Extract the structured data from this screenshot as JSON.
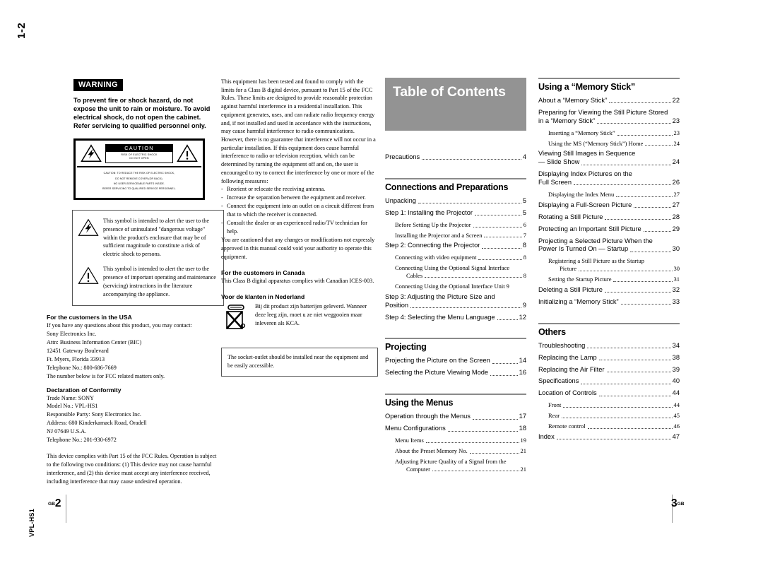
{
  "page": {
    "section_marker": "1-2",
    "model_marker": "VPL-HS1",
    "footer_left_page": "2",
    "footer_left_suffix": "GB",
    "footer_right_page": "3",
    "footer_right_suffix": "GB"
  },
  "warning": {
    "badge": "WARNING",
    "body": "To prevent fire or shock hazard, do not expose the unit to rain or moisture.\nTo avoid electrical shock, do not open the cabinet.  Refer servicing to qualified personnel only."
  },
  "caution_label": {
    "word": "CAUTION",
    "sub_line1": "RISK OF ELECTRIC SHOCK",
    "sub_line2": "DO NOT OPEN",
    "bottom_lines": [
      "CAUTION: TO REDUCE THE RISK OF ELECTRIC SHOCK,",
      "DO NOT REMOVE COVER (OR BACK).",
      "NO USER-SERVICEABLE PARTS INSIDE.",
      "REFER SERVICING TO QUALIFIED SERVICE PERSONNEL."
    ]
  },
  "symbol_box": {
    "lightning_text": "This symbol is intended to alert the user to the presence of uninsulated \"dangerous voltage\" within the product's enclosure that may be of sufficient magnitude to constitute a risk of electric shock to persons.",
    "exclamation_text": "This symbol is intended to alert the user to the presence of important operating and maintenance (servicing) instructions in the literature accompanying the appliance."
  },
  "usa": {
    "heading": "For the customers in the USA",
    "intro": "If you have any questions about this product, you may contact:",
    "address_lines": [
      "Sony Electronics Inc.",
      "Attn: Business Information Center (BIC)",
      "12451 Gateway Boulevard",
      "Ft. Myers, Florida 33913",
      "Telephone No.: 800-686-7669"
    ],
    "note": "The number below is for FCC related matters only."
  },
  "doc": {
    "heading": "Declaration of Conformity",
    "lines": [
      "Trade Name: SONY",
      "Model No.: VPL-HS1",
      "Responsible Party: Sony Electronics Inc.",
      "Address: 680 Kinderkamack Road, Oradell",
      "NJ 07649 U.S.A.",
      "Telephone No.: 201-930-6972"
    ]
  },
  "fcc_part15": "This device complies with Part 15 of the FCC Rules. Operation is subject to the following two conditions: (1) This device may not cause harmful interference, and (2) this device must accept any interference received, including interference that may cause undesired operation.",
  "fcc_statement": {
    "paragraph": "This equipment has been tested and found to comply with the limits for a Class B digital device, pursuant to Part 15 of the FCC Rules.  These limits are designed to provide reasonable protection against harmful interference in a residential installation.  This equipment generates, uses, and can radiate radio frequency energy and, if not installed and used in accordance with the instructions, may cause harmful interference to radio communications.  However, there is no guarantee that interference will not occur in a particular installation. If this equipment does cause harmful interference to radio or television reception, which can be determined by turning the equipment off and on, the user is encouraged to try to correct the interference by one or more of the following measures:",
    "measures": [
      "Reorient or relocate the receiving antenna.",
      "Increase the separation between the equipment and receiver.",
      "Connect the equipment into an outlet on a circuit different from that to which the receiver is connected.",
      "Consult the dealer or an experienced radio/TV technician for help."
    ],
    "caution": "You are cautioned that any changes or modifications not expressly approved in this manual could void your authority to operate this equipment."
  },
  "canada": {
    "heading": "For the customers in Canada",
    "body": "This Class B digital apparatus complies with Canadian ICES-003."
  },
  "netherlands": {
    "heading": "Voor de klanten in Nederland",
    "body": "Bij dit product zijn batterijen geleverd. Wanneer deze leeg zijn, moet u ze niet weggooien maar inleveren als KCA."
  },
  "socket_note": "The socket-outlet should be installed near the equipment and be easily accessible.",
  "toc": {
    "title": "Table of Contents",
    "precautions": {
      "label": "Precautions",
      "page": "4"
    },
    "sections": [
      {
        "heading": "Connections and Preparations",
        "entries": [
          {
            "label": "Unpacking",
            "page": "5",
            "level": "main"
          },
          {
            "label": "Step 1: Installing the Projector",
            "page": "5",
            "level": "main"
          },
          {
            "label": "Before Setting Up the Projector",
            "page": "6",
            "level": "sub"
          },
          {
            "label": "Installing the Projector and a Screen",
            "page": "7",
            "level": "sub"
          },
          {
            "label": "Step 2: Connecting the Projector",
            "page": "8",
            "level": "main"
          },
          {
            "label": "Connecting with video equipment",
            "page": "8",
            "level": "sub"
          },
          {
            "line1": "Connecting Using the Optional Signal Interface",
            "line2": "Cables",
            "page": "8",
            "level": "sub-multi"
          },
          {
            "line1": "Connecting Using the Optional Interface Unit 9",
            "line2": "",
            "page": "",
            "level": "sub-nodots"
          },
          {
            "line1": "Step 3: Adjusting the Picture Size and",
            "line2": "Position",
            "page": "9",
            "level": "main-multi"
          },
          {
            "label": "Step 4: Selecting the Menu Language",
            "page": "12",
            "level": "main"
          }
        ]
      },
      {
        "heading": "Projecting",
        "entries": [
          {
            "label": "Projecting the Picture on the Screen",
            "page": "14",
            "level": "main"
          },
          {
            "label": "Selecting the Picture Viewing Mode",
            "page": "16",
            "level": "main"
          }
        ]
      },
      {
        "heading": "Using the Menus",
        "entries": [
          {
            "label": "Operation through the Menus",
            "page": "17",
            "level": "main"
          },
          {
            "label": "Menu Configurations",
            "page": "18",
            "level": "main"
          },
          {
            "label": "Menu Items",
            "page": "19",
            "level": "sub"
          },
          {
            "label": "About the Preset Memory No.",
            "page": "21",
            "level": "sub"
          },
          {
            "line1": "Adjusting Picture Quality of a Signal from the",
            "line2": "Computer",
            "page": "21",
            "level": "sub-multi"
          }
        ]
      }
    ],
    "sections_right": [
      {
        "heading": "Using a “Memory Stick”",
        "entries": [
          {
            "label": "About a “Memory Stick”",
            "page": "22",
            "level": "main"
          },
          {
            "line1": "Preparing for Viewing the Still Picture Stored",
            "line2": "in a “Memory Stick”",
            "page": "23",
            "level": "main-multi"
          },
          {
            "label": "Inserting a “Memory Stick”",
            "page": "23",
            "level": "sub"
          },
          {
            "label": "Using the MS (“Memory Stick”) Home",
            "page": "24",
            "level": "sub"
          },
          {
            "line1": "Viewing Still Images in Sequence",
            "line2": "— Slide Show",
            "page": "24",
            "level": "main-multi"
          },
          {
            "line1": "Displaying Index Pictures on the",
            "line2": "Full Screen",
            "page": "26",
            "level": "main-multi"
          },
          {
            "label": "Displaying the Index Menu",
            "page": "27",
            "level": "sub"
          },
          {
            "label": "Displaying a Full-Screen Picture",
            "page": "27",
            "level": "main"
          },
          {
            "label": "Rotating a Still Picture",
            "page": "28",
            "level": "main"
          },
          {
            "label": "Protecting an Important Still Picture",
            "page": "29",
            "level": "main"
          },
          {
            "line1": "Projecting a Selected Picture When the",
            "line2": "Power Is Turned On — Startup",
            "page": "30",
            "level": "main-multi"
          },
          {
            "line1": "Registering a Still Picture as the Startup",
            "line2": "Picture",
            "page": "30",
            "level": "sub-multi"
          },
          {
            "label": "Setting the Startup Picture",
            "page": "31",
            "level": "sub"
          },
          {
            "label": "Deleting a Still Picture",
            "page": "32",
            "level": "main"
          },
          {
            "label": "Initializing a “Memory Stick”",
            "page": "33",
            "level": "main"
          }
        ]
      },
      {
        "heading": "Others",
        "entries": [
          {
            "label": "Troubleshooting",
            "page": "34",
            "level": "main"
          },
          {
            "label": "Replacing the Lamp",
            "page": "38",
            "level": "main"
          },
          {
            "label": "Replacing the Air Filter",
            "page": "39",
            "level": "main"
          },
          {
            "label": "Specifications",
            "page": "40",
            "level": "main"
          },
          {
            "label": "Location of Controls",
            "page": "44",
            "level": "main"
          },
          {
            "label": "Front",
            "page": "44",
            "level": "sub"
          },
          {
            "label": "Rear",
            "page": "45",
            "level": "sub"
          },
          {
            "label": "Remote control",
            "page": "46",
            "level": "sub"
          },
          {
            "label": "Index",
            "page": "47",
            "level": "main"
          }
        ]
      }
    ]
  }
}
